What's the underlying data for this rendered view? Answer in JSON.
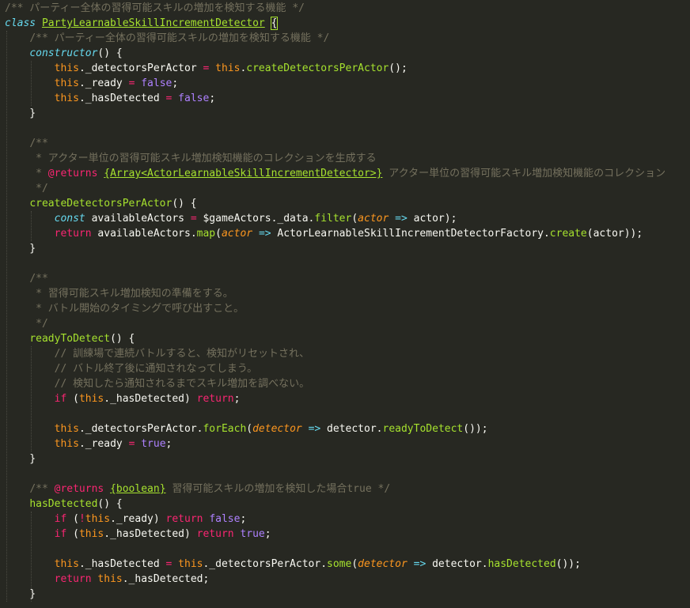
{
  "editor": {
    "theme_colors": {
      "background": "#272822",
      "comment": "#75715e",
      "keyword": "#f92672",
      "storage": "#66d9ef",
      "this": "#fd971f",
      "constant": "#ae81ff",
      "function": "#a6e22e",
      "text": "#f8f8f2"
    },
    "lines": [
      [
        [
          "/** パーティー全体の習得可能スキルの増加を検知する機能 */",
          "comment"
        ]
      ],
      [
        [
          "class",
          "storage"
        ],
        [
          " ",
          "plain"
        ],
        [
          "PartyLearnableSkillIncrementDetector",
          "classname"
        ],
        [
          " ",
          "plain"
        ],
        [
          "{",
          "bracket"
        ]
      ],
      [
        [
          "    ",
          "plain"
        ],
        [
          "/** パーティー全体の習得可能スキルの増加を検知する機能 */",
          "comment"
        ]
      ],
      [
        [
          "    ",
          "plain"
        ],
        [
          "constructor",
          "storage"
        ],
        [
          "() {",
          "plain"
        ]
      ],
      [
        [
          "        ",
          "plain"
        ],
        [
          "this",
          "this"
        ],
        [
          "._detectorsPerActor ",
          "plain"
        ],
        [
          "=",
          "keyword"
        ],
        [
          " ",
          "plain"
        ],
        [
          "this",
          "this"
        ],
        [
          ".",
          "plain"
        ],
        [
          "createDetectorsPerActor",
          "func"
        ],
        [
          "();",
          "plain"
        ]
      ],
      [
        [
          "        ",
          "plain"
        ],
        [
          "this",
          "this"
        ],
        [
          "._ready ",
          "plain"
        ],
        [
          "=",
          "keyword"
        ],
        [
          " ",
          "plain"
        ],
        [
          "false",
          "bool"
        ],
        [
          ";",
          "plain"
        ]
      ],
      [
        [
          "        ",
          "plain"
        ],
        [
          "this",
          "this"
        ],
        [
          "._hasDetected ",
          "plain"
        ],
        [
          "=",
          "keyword"
        ],
        [
          " ",
          "plain"
        ],
        [
          "false",
          "bool"
        ],
        [
          ";",
          "plain"
        ]
      ],
      [
        [
          "    }",
          "plain"
        ]
      ],
      [
        [
          "",
          "plain"
        ]
      ],
      [
        [
          "    ",
          "plain"
        ],
        [
          "/**",
          "comment"
        ]
      ],
      [
        [
          "     ",
          "plain"
        ],
        [
          "* アクター単位の習得可能スキル増加検知機能のコレクションを生成する",
          "comment"
        ]
      ],
      [
        [
          "     ",
          "plain"
        ],
        [
          "* ",
          "comment"
        ],
        [
          "@returns",
          "keyword"
        ],
        [
          " ",
          "comment"
        ],
        [
          "{Array<ActorLearnableSkillIncrementDetector>}",
          "type"
        ],
        [
          " アクター単位の習得可能スキル増加検知機能のコレクション",
          "comment"
        ]
      ],
      [
        [
          "     ",
          "plain"
        ],
        [
          "*/",
          "comment"
        ]
      ],
      [
        [
          "    ",
          "plain"
        ],
        [
          "createDetectorsPerActor",
          "func"
        ],
        [
          "() {",
          "plain"
        ]
      ],
      [
        [
          "        ",
          "plain"
        ],
        [
          "const",
          "storage"
        ],
        [
          " availableActors ",
          "plain"
        ],
        [
          "=",
          "keyword"
        ],
        [
          " $gameActors._data.",
          "plain"
        ],
        [
          "filter",
          "func"
        ],
        [
          "(",
          "plain"
        ],
        [
          "actor",
          "param"
        ],
        [
          " ",
          "plain"
        ],
        [
          "=>",
          "storage"
        ],
        [
          " actor);",
          "plain"
        ]
      ],
      [
        [
          "        ",
          "plain"
        ],
        [
          "return",
          "keyword"
        ],
        [
          " availableActors.",
          "plain"
        ],
        [
          "map",
          "func"
        ],
        [
          "(",
          "plain"
        ],
        [
          "actor",
          "param"
        ],
        [
          " ",
          "plain"
        ],
        [
          "=>",
          "storage"
        ],
        [
          " ActorLearnableSkillIncrementDetectorFactory.",
          "plain"
        ],
        [
          "create",
          "func"
        ],
        [
          "(actor));",
          "plain"
        ]
      ],
      [
        [
          "    }",
          "plain"
        ]
      ],
      [
        [
          "",
          "plain"
        ]
      ],
      [
        [
          "    ",
          "plain"
        ],
        [
          "/**",
          "comment"
        ]
      ],
      [
        [
          "     ",
          "plain"
        ],
        [
          "* 習得可能スキル増加検知の準備をする。",
          "comment"
        ]
      ],
      [
        [
          "     ",
          "plain"
        ],
        [
          "* バトル開始のタイミングで呼び出すこと。",
          "comment"
        ]
      ],
      [
        [
          "     ",
          "plain"
        ],
        [
          "*/",
          "comment"
        ]
      ],
      [
        [
          "    ",
          "plain"
        ],
        [
          "readyToDetect",
          "func"
        ],
        [
          "() {",
          "plain"
        ]
      ],
      [
        [
          "        ",
          "plain"
        ],
        [
          "// 訓練場で連続バトルすると、検知がリセットされ、",
          "comment"
        ]
      ],
      [
        [
          "        ",
          "plain"
        ],
        [
          "// バトル終了後に通知されなってしまう。",
          "comment"
        ]
      ],
      [
        [
          "        ",
          "plain"
        ],
        [
          "// 検知したら通知されるまでスキル増加を調べない。",
          "comment"
        ]
      ],
      [
        [
          "        ",
          "plain"
        ],
        [
          "if",
          "keyword"
        ],
        [
          " (",
          "plain"
        ],
        [
          "this",
          "this"
        ],
        [
          "._hasDetected) ",
          "plain"
        ],
        [
          "return",
          "keyword"
        ],
        [
          ";",
          "plain"
        ]
      ],
      [
        [
          "",
          "plain"
        ]
      ],
      [
        [
          "        ",
          "plain"
        ],
        [
          "this",
          "this"
        ],
        [
          "._detectorsPerActor.",
          "plain"
        ],
        [
          "forEach",
          "func"
        ],
        [
          "(",
          "plain"
        ],
        [
          "detector",
          "param"
        ],
        [
          " ",
          "plain"
        ],
        [
          "=>",
          "storage"
        ],
        [
          " detector.",
          "plain"
        ],
        [
          "readyToDetect",
          "func"
        ],
        [
          "());",
          "plain"
        ]
      ],
      [
        [
          "        ",
          "plain"
        ],
        [
          "this",
          "this"
        ],
        [
          "._ready ",
          "plain"
        ],
        [
          "=",
          "keyword"
        ],
        [
          " ",
          "plain"
        ],
        [
          "true",
          "bool"
        ],
        [
          ";",
          "plain"
        ]
      ],
      [
        [
          "    }",
          "plain"
        ]
      ],
      [
        [
          "",
          "plain"
        ]
      ],
      [
        [
          "    ",
          "plain"
        ],
        [
          "/** ",
          "comment"
        ],
        [
          "@returns",
          "keyword"
        ],
        [
          " ",
          "comment"
        ],
        [
          "{boolean}",
          "type"
        ],
        [
          " 習得可能スキルの増加を検知した場合true */",
          "comment"
        ]
      ],
      [
        [
          "    ",
          "plain"
        ],
        [
          "hasDetected",
          "func"
        ],
        [
          "() {",
          "plain"
        ]
      ],
      [
        [
          "        ",
          "plain"
        ],
        [
          "if",
          "keyword"
        ],
        [
          " (",
          "plain"
        ],
        [
          "!",
          "keyword"
        ],
        [
          "this",
          "this"
        ],
        [
          "._ready) ",
          "plain"
        ],
        [
          "return",
          "keyword"
        ],
        [
          " ",
          "plain"
        ],
        [
          "false",
          "bool"
        ],
        [
          ";",
          "plain"
        ]
      ],
      [
        [
          "        ",
          "plain"
        ],
        [
          "if",
          "keyword"
        ],
        [
          " (",
          "plain"
        ],
        [
          "this",
          "this"
        ],
        [
          "._hasDetected) ",
          "plain"
        ],
        [
          "return",
          "keyword"
        ],
        [
          " ",
          "plain"
        ],
        [
          "true",
          "bool"
        ],
        [
          ";",
          "plain"
        ]
      ],
      [
        [
          "",
          "plain"
        ]
      ],
      [
        [
          "        ",
          "plain"
        ],
        [
          "this",
          "this"
        ],
        [
          "._hasDetected ",
          "plain"
        ],
        [
          "=",
          "keyword"
        ],
        [
          " ",
          "plain"
        ],
        [
          "this",
          "this"
        ],
        [
          "._detectorsPerActor.",
          "plain"
        ],
        [
          "some",
          "func"
        ],
        [
          "(",
          "plain"
        ],
        [
          "detector",
          "param"
        ],
        [
          " ",
          "plain"
        ],
        [
          "=>",
          "storage"
        ],
        [
          " detector.",
          "plain"
        ],
        [
          "hasDetected",
          "func"
        ],
        [
          "());",
          "plain"
        ]
      ],
      [
        [
          "        ",
          "plain"
        ],
        [
          "return",
          "keyword"
        ],
        [
          " ",
          "plain"
        ],
        [
          "this",
          "this"
        ],
        [
          "._hasDetected;",
          "plain"
        ]
      ],
      [
        [
          "    }",
          "plain"
        ]
      ]
    ]
  }
}
